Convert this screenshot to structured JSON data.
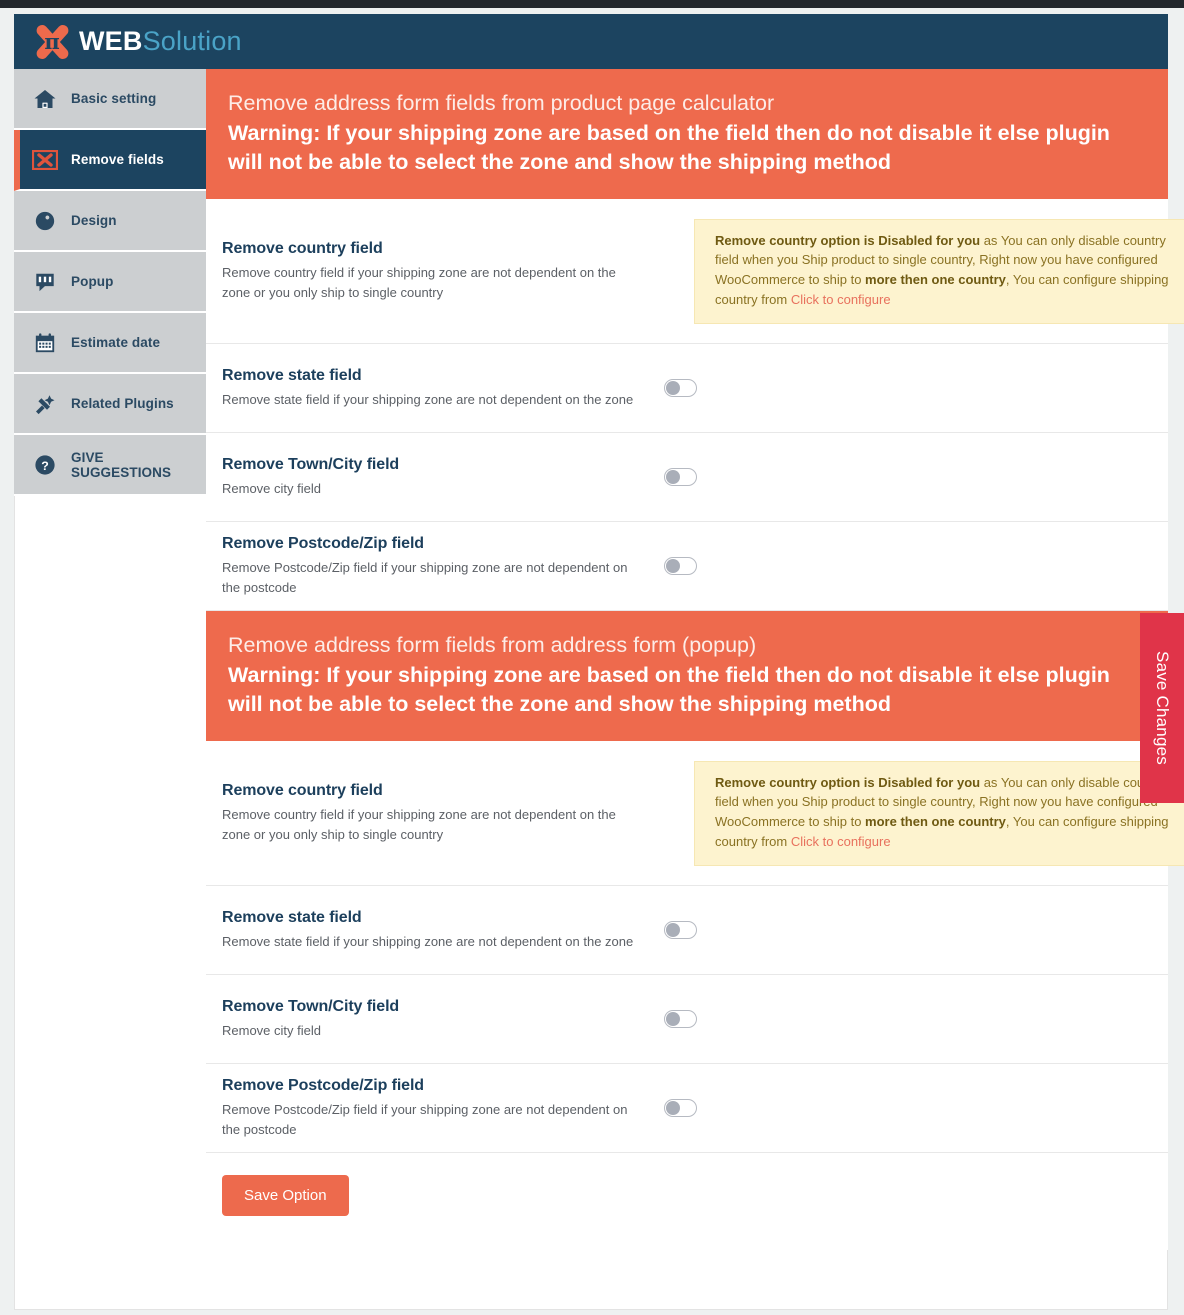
{
  "brand": {
    "logo_icon": "pi-x-logo-icon",
    "name_primary": "WEB",
    "name_secondary": "Solution"
  },
  "sidebar": {
    "items": [
      {
        "label": "Basic setting",
        "icon": "home-icon",
        "active": false
      },
      {
        "label": "Remove fields",
        "icon": "remove-fields-x-box-icon",
        "active": true
      },
      {
        "label": "Design",
        "icon": "design-droplet-icon",
        "active": false
      },
      {
        "label": "Popup",
        "icon": "popup-speech-bubble-icon",
        "active": false
      },
      {
        "label": "Estimate date",
        "icon": "calendar-icon",
        "active": false
      },
      {
        "label": "Related Plugins",
        "icon": "plug-icon",
        "active": false
      },
      {
        "label": "GIVE SUGGESTIONS",
        "icon": "question-circle-icon",
        "active": false
      }
    ]
  },
  "save_changes_tab": {
    "label": "Save Changes"
  },
  "sections": [
    {
      "title": "Remove address form fields from product page calculator",
      "warning": "Warning: If your shipping zone are based on the field then do not disable it else plugin will not be able to select the zone and show the shipping method",
      "rows": [
        {
          "title": "Remove country field",
          "desc": "Remove country field if your shipping zone are not dependent on the zone or you only ship to single country",
          "control": "notice",
          "notice": {
            "bold_lead": "Remove country option is Disabled for you",
            "text_1": " as You can only disable country field when you Ship product to single country, Right now you have configured WooCommerce to ship to ",
            "bold_mid": "more then one country",
            "text_2": ", You can configure shipping country from ",
            "link": "Click to configure"
          }
        },
        {
          "title": "Remove state field",
          "desc": "Remove state field if your shipping zone are not dependent on the zone",
          "control": "toggle",
          "toggle_state": "off"
        },
        {
          "title": "Remove Town/City field",
          "desc": "Remove city field",
          "control": "toggle",
          "toggle_state": "off"
        },
        {
          "title": "Remove Postcode/Zip field",
          "desc": "Remove Postcode/Zip field if your shipping zone are not dependent on the postcode",
          "control": "toggle",
          "toggle_state": "off"
        }
      ]
    },
    {
      "title": "Remove address form fields from address form (popup)",
      "warning": "Warning: If your shipping zone are based on the field then do not disable it else plugin will not be able to select the zone and show the shipping method",
      "rows": [
        {
          "title": "Remove country field",
          "desc": "Remove country field if your shipping zone are not dependent on the zone or you only ship to single country",
          "control": "notice",
          "notice": {
            "bold_lead": "Remove country option is Disabled for you",
            "text_1": " as You can only disable country field when you Ship product to single country, Right now you have configured WooCommerce to ship to ",
            "bold_mid": "more then one country",
            "text_2": ", You can configure shipping country from ",
            "link": "Click to configure"
          }
        },
        {
          "title": "Remove state field",
          "desc": "Remove state field if your shipping zone are not dependent on the zone",
          "control": "toggle",
          "toggle_state": "off"
        },
        {
          "title": "Remove Town/City field",
          "desc": "Remove city field",
          "control": "toggle",
          "toggle_state": "off"
        },
        {
          "title": "Remove Postcode/Zip field",
          "desc": "Remove Postcode/Zip field if your shipping zone are not dependent on the postcode",
          "control": "toggle",
          "toggle_state": "off"
        }
      ]
    }
  ],
  "footer": {
    "save_option_label": "Save Option"
  },
  "colors": {
    "brand_navy": "#1c4460",
    "accent_orange": "#ed6a4d",
    "save_changes_red": "#e03449",
    "notice_bg": "#fdf3cf",
    "sidebar_gray": "#cccfd1"
  }
}
